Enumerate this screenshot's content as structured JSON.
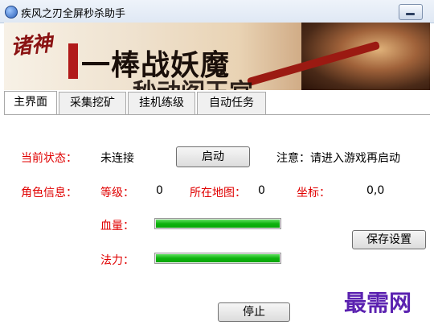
{
  "window": {
    "title": "疾风之刃全屏秒杀助手"
  },
  "banner": {
    "logo_text": "诸神",
    "slogan": "一棒战妖魔",
    "slogan_line2": "秒动阎王宫"
  },
  "tabs": [
    {
      "label": "主界面",
      "active": true
    },
    {
      "label": "采集挖矿",
      "active": false
    },
    {
      "label": "挂机练级",
      "active": false
    },
    {
      "label": "自动任务",
      "active": false
    }
  ],
  "status": {
    "label": "当前状态：",
    "value": "未连接",
    "start_button": "启动",
    "notice": "注意：请进入游戏再启动"
  },
  "role": {
    "label": "角色信息：",
    "level_label": "等级：",
    "level_value": "0",
    "map_label": "所在地图：",
    "map_value": "0",
    "coord_label": "坐标：",
    "coord_value": "0,0"
  },
  "hp": {
    "label": "血量：",
    "fraction": 1.0
  },
  "mp": {
    "label": "法力：",
    "fraction": 1.0
  },
  "save_button": "保存设置",
  "stop_button": "停止",
  "watermark": "最需网",
  "colors": {
    "label_red": "#e00000",
    "bar_green": "#0fb30f",
    "watermark": "#5b22b0"
  }
}
